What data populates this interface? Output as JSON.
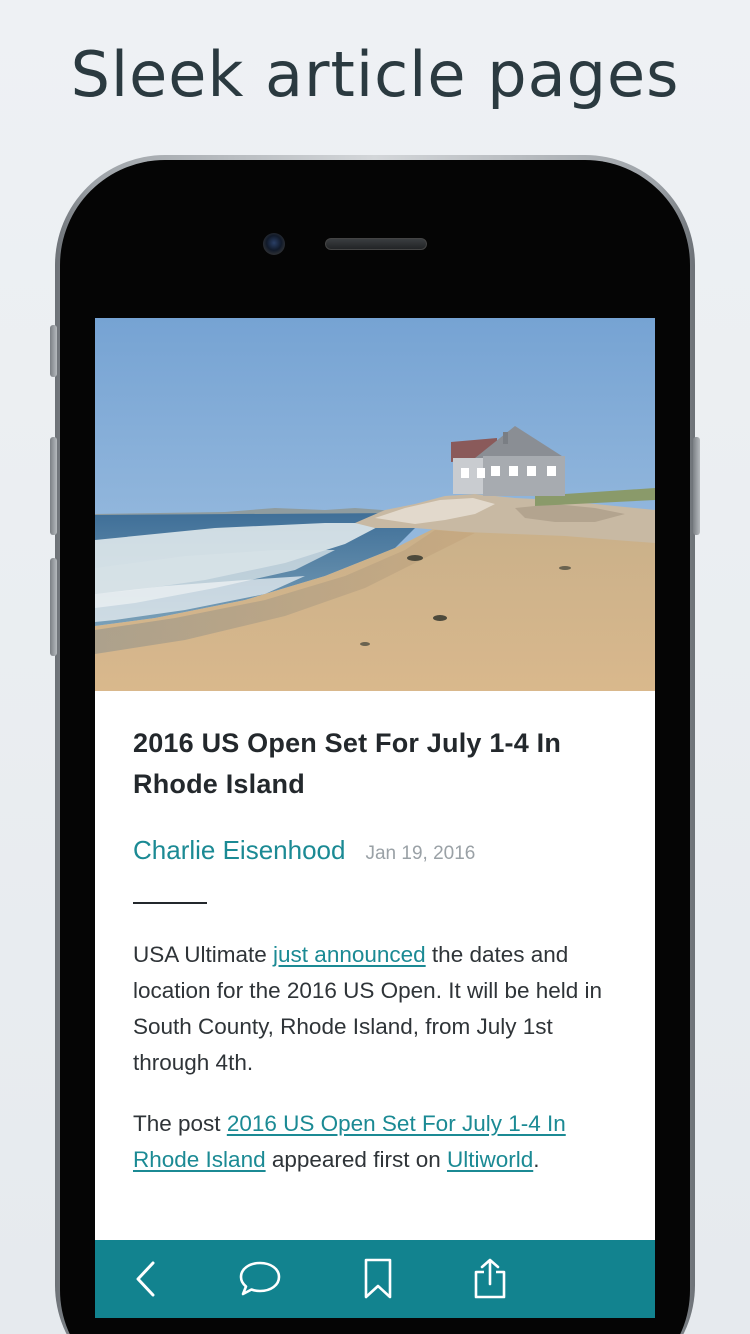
{
  "promo": {
    "headline": "Sleek article pages"
  },
  "article": {
    "title": "2016 US Open Set For July 1-4 In Rhode Island",
    "author": "Charlie Eisenhood",
    "date": "Jan 19, 2016",
    "paragraph1": {
      "before": "USA Ultimate ",
      "link": "just announced",
      "after": " the dates and location for the 2016 US Open. It will be held in South County, Rhode Island, from July 1st through 4th."
    },
    "paragraph2": {
      "before": "The post ",
      "link": "2016 US Open Set For July 1-4 In Rhode Island",
      "middle": " appeared first on ",
      "source_link": "Ultiworld",
      "after": "."
    }
  },
  "toolbar": {
    "back_icon": "chevron-left-icon",
    "comments_icon": "speech-bubble-icon",
    "bookmark_icon": "bookmark-icon",
    "share_icon": "share-icon"
  },
  "colors": {
    "accent": "#1b8a94",
    "toolbar": "#12838f",
    "title_text": "#23282c",
    "date_text": "#9aa1a6"
  }
}
